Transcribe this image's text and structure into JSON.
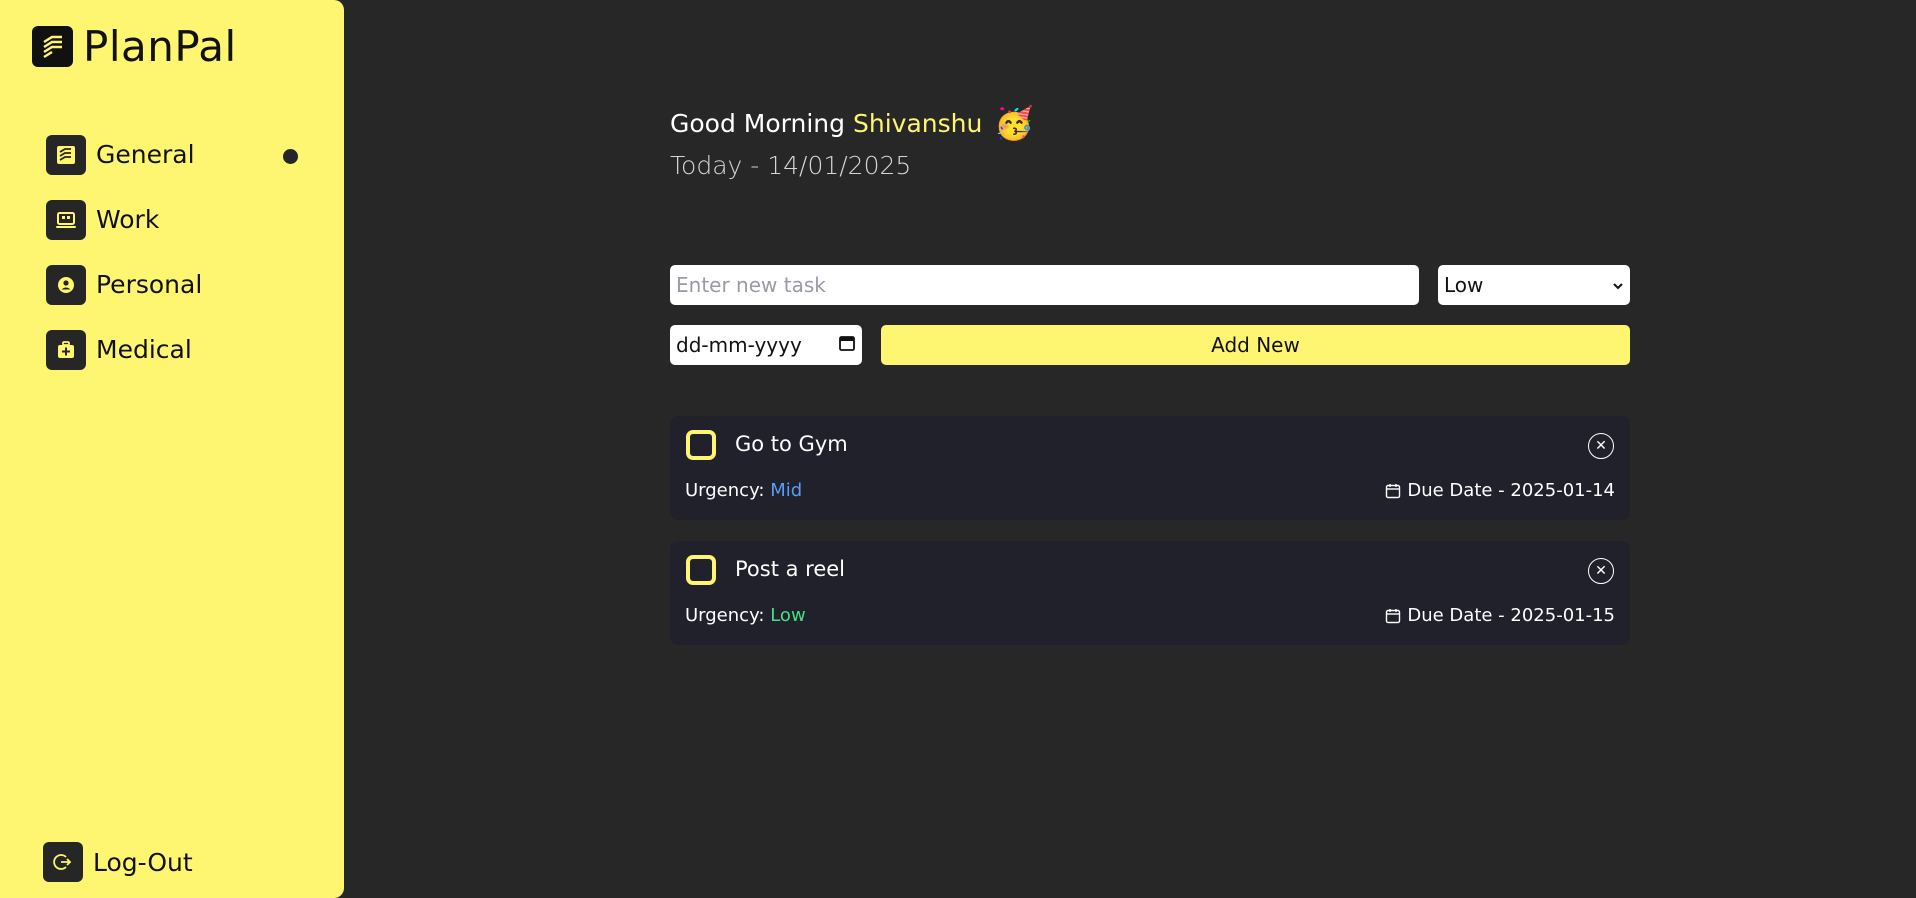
{
  "app": {
    "name": "PlanPal"
  },
  "sidebar": {
    "items": [
      {
        "label": "General",
        "icon": "checklist-icon",
        "active": true
      },
      {
        "label": "Work",
        "icon": "laptop-icon",
        "active": false
      },
      {
        "label": "Personal",
        "icon": "user-circle-icon",
        "active": false
      },
      {
        "label": "Medical",
        "icon": "medical-kit-icon",
        "active": false
      }
    ],
    "logout_label": "Log-Out"
  },
  "header": {
    "greeting": "Good Morning",
    "user_name": "Shivanshu",
    "emoji": "🥳",
    "today": "Today - 14/01/2025"
  },
  "form": {
    "task_placeholder": "Enter new task",
    "urgency_value": "Low",
    "date_placeholder": "dd-mm-yyyy",
    "add_label": "Add New"
  },
  "tasks": [
    {
      "title": "Go to Gym",
      "urgency_label": "Urgency:",
      "urgency": "Mid",
      "urgency_color": "#5a9cf8",
      "due": "Due Date - 2025-01-14"
    },
    {
      "title": "Post a reel",
      "urgency_label": "Urgency:",
      "urgency": "Low",
      "urgency_color": "#4ade80",
      "due": "Due Date - 2025-01-15"
    }
  ],
  "colors": {
    "accent": "#fef570",
    "background": "#272727",
    "card": "#20212b"
  }
}
